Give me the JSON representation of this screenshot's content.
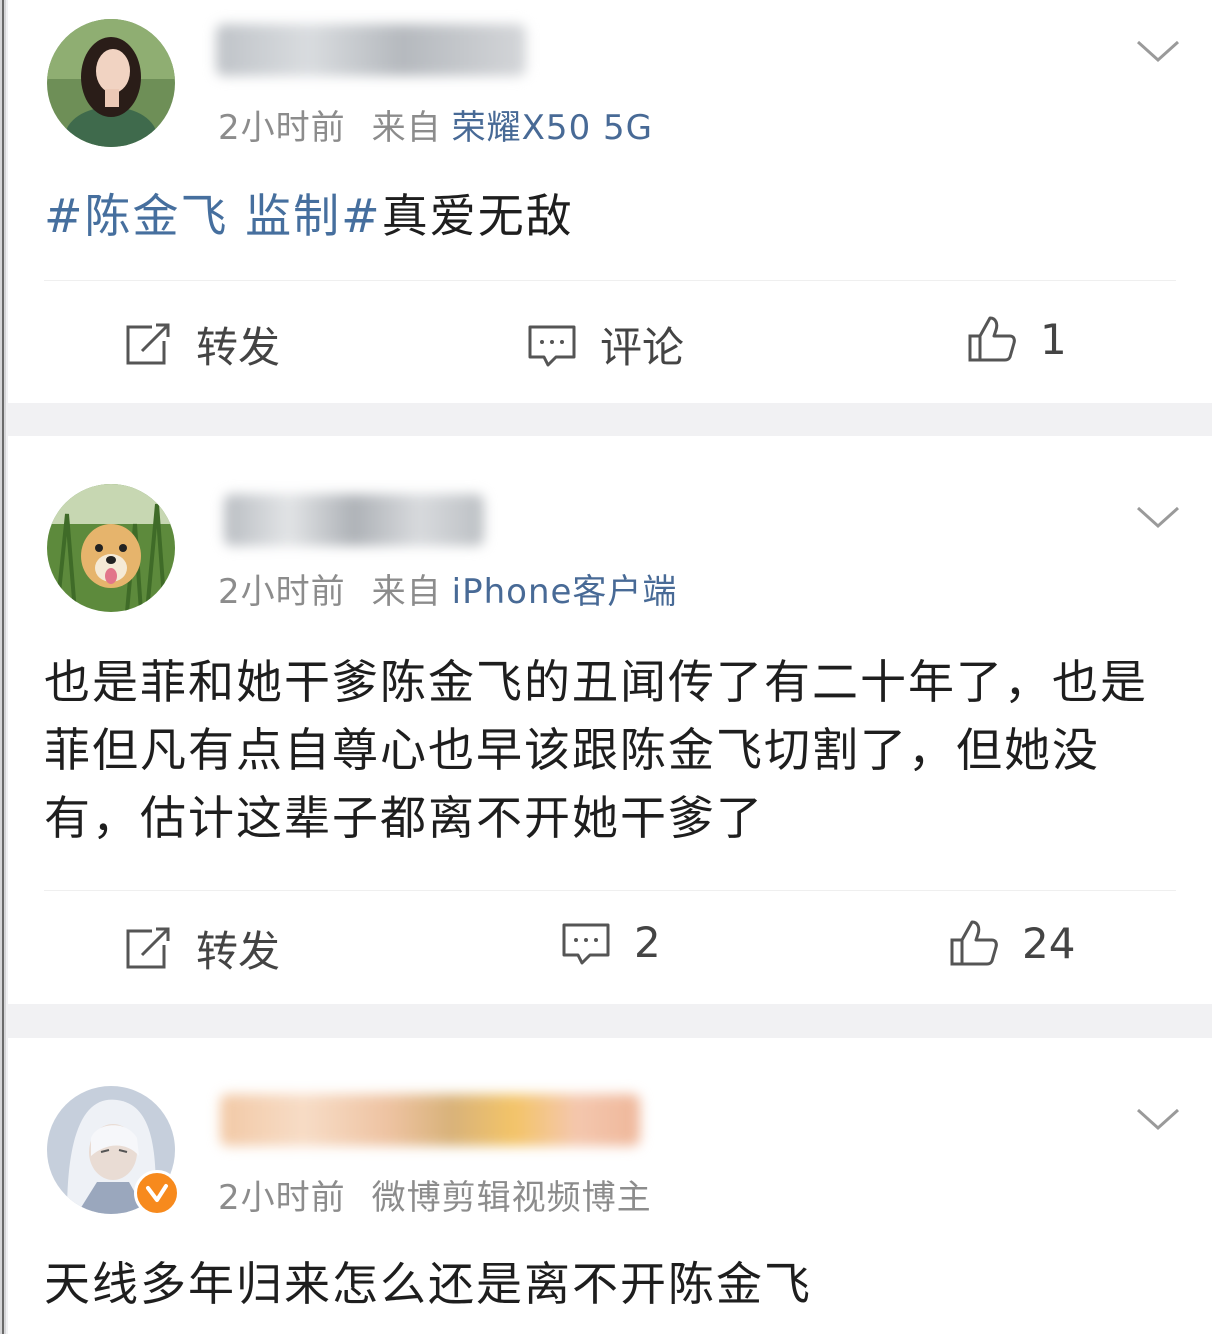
{
  "posts": [
    {
      "time": "2小时前",
      "source_prefix": "来自",
      "source": "荣耀X50 5G",
      "hashtag": "#陈金飞 监制#",
      "text": "真爱无敌",
      "actions": {
        "repost": "转发",
        "comment": "评论",
        "like": "1"
      }
    },
    {
      "time": "2小时前",
      "source_prefix": "来自",
      "source": "iPhone客户端",
      "text": "也是菲和她干爹陈金飞的丑闻传了有二十年了，也是菲但凡有点自尊心也早该跟陈金飞切割了，但她没有，估计这辈子都离不开她干爹了",
      "actions": {
        "repost": "转发",
        "comment": "2",
        "like": "24"
      }
    },
    {
      "time": "2小时前",
      "source": "微博剪辑视频博主",
      "text": "天线多年归来怎么还是离不开陈金飞"
    }
  ],
  "icons": {
    "repost": "repost-icon",
    "comment": "comment-icon",
    "like": "thumbs-up-icon",
    "menu": "chevron-down-icon",
    "verified": "verified-badge-icon"
  },
  "colors": {
    "link": "#466f9e",
    "meta": "#8c8c8c",
    "verified": "#f78a1d",
    "separator": "#f1f1f3"
  }
}
